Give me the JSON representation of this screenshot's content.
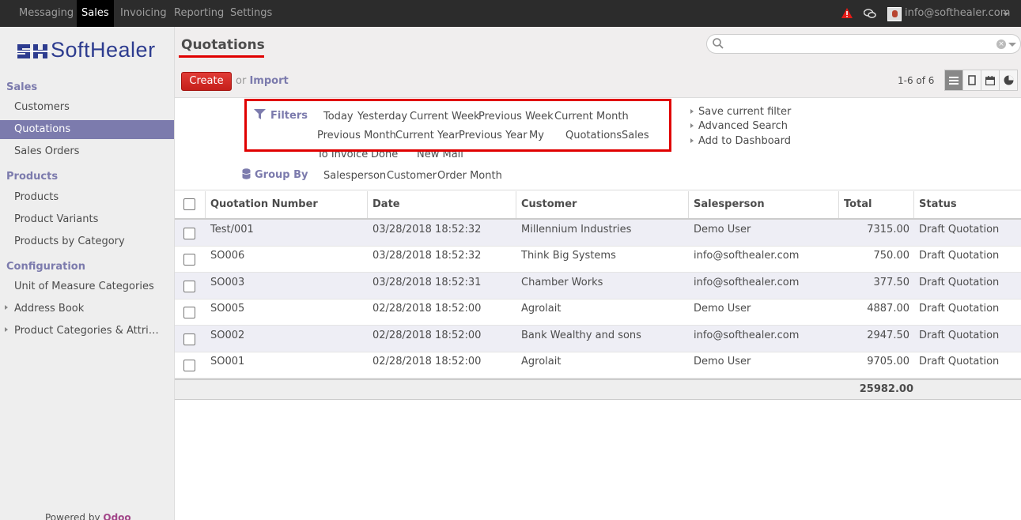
{
  "topbar": {
    "menus": [
      "Messaging",
      "Sales",
      "Invoicing",
      "Reporting",
      "Settings"
    ],
    "active_menu": "Sales",
    "user_email": "info@softhealer.com"
  },
  "sidebar": {
    "logo_text": "SoftHealer",
    "sections": [
      {
        "title": "Sales",
        "items": [
          "Customers",
          "Quotations",
          "Sales Orders"
        ]
      },
      {
        "title": "Products",
        "items": [
          "Products",
          "Product Variants",
          "Products by Category"
        ]
      },
      {
        "title": "Configuration",
        "items": [
          "Unit of Measure Categories",
          "Address Book",
          "Product Categories & Attri…"
        ]
      }
    ],
    "active_item": "Quotations",
    "powered_by": "Powered by",
    "powered_brand": "Odoo"
  },
  "control": {
    "title": "Quotations",
    "create_label": "Create",
    "or_label": "or",
    "import_label": "Import",
    "pager": "1-6 of 6",
    "search_placeholder": ""
  },
  "drawer": {
    "filters_label": "Filters",
    "filters": [
      "Today",
      "Yesterday",
      "Current Week",
      "Previous Week",
      "Current Month",
      "Previous Month",
      "Current Year",
      "Previous Year",
      "My",
      "Quotations",
      "Sales",
      "To Invoice",
      "Done",
      "New Mail"
    ],
    "group_by_label": "Group By",
    "group_by": [
      "Salesperson",
      "Customer",
      "Order Month"
    ],
    "favorites": [
      "Save current filter",
      "Advanced Search",
      "Add to Dashboard"
    ]
  },
  "table": {
    "columns": [
      "Quotation Number",
      "Date",
      "Customer",
      "Salesperson",
      "Total",
      "Status"
    ],
    "rows": [
      {
        "number": "Test/001",
        "date": "03/28/2018 18:52:32",
        "customer": "Millennium Industries",
        "salesperson": "Demo User",
        "total": "7315.00",
        "status": "Draft Quotation"
      },
      {
        "number": "SO006",
        "date": "03/28/2018 18:52:32",
        "customer": "Think Big Systems",
        "salesperson": "info@softhealer.com",
        "total": "750.00",
        "status": "Draft Quotation"
      },
      {
        "number": "SO003",
        "date": "03/28/2018 18:52:31",
        "customer": "Chamber Works",
        "salesperson": "info@softhealer.com",
        "total": "377.50",
        "status": "Draft Quotation"
      },
      {
        "number": "SO005",
        "date": "02/28/2018 18:52:00",
        "customer": "Agrolait",
        "salesperson": "Demo User",
        "total": "4887.00",
        "status": "Draft Quotation"
      },
      {
        "number": "SO002",
        "date": "02/28/2018 18:52:00",
        "customer": "Bank Wealthy and sons",
        "salesperson": "info@softhealer.com",
        "total": "2947.50",
        "status": "Draft Quotation"
      },
      {
        "number": "SO001",
        "date": "02/28/2018 18:52:00",
        "customer": "Agrolait",
        "salesperson": "Demo User",
        "total": "9705.00",
        "status": "Draft Quotation"
      }
    ],
    "grand_total": "25982.00"
  },
  "colors": {
    "topbar": "#2c2c2c",
    "accent": "#7c7bad",
    "create": "#d9221e",
    "highlight": "#e00000"
  }
}
